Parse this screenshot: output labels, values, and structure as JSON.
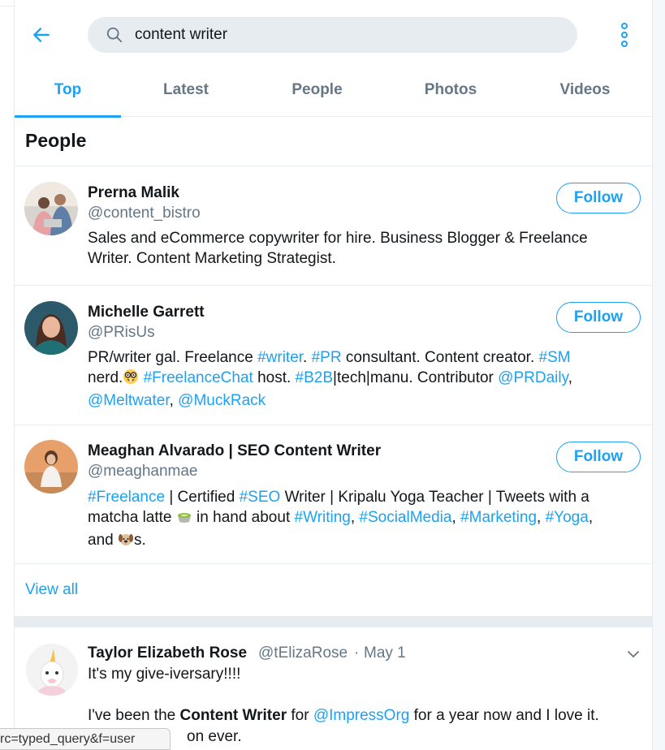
{
  "search": {
    "query": "content writer",
    "back_icon": "arrow-left-icon",
    "search_icon": "search-icon",
    "more_icon": "vertical-dots-icon"
  },
  "tabs": [
    {
      "label": "Top",
      "active": true
    },
    {
      "label": "Latest",
      "active": false
    },
    {
      "label": "People",
      "active": false
    },
    {
      "label": "Photos",
      "active": false
    },
    {
      "label": "Videos",
      "active": false
    }
  ],
  "people_section": {
    "title": "People",
    "view_all_label": "View all",
    "follow_label": "Follow",
    "people": [
      {
        "name": "Prerna Malik",
        "handle": "@content_bistro",
        "bio": {
          "line1": "Sales and eCommerce copywriter for hire. Business Blogger & Freelance",
          "line2": "Writer. Content Marketing Strategist."
        }
      },
      {
        "name": "Michelle Garrett",
        "handle": "@PRisUs",
        "bio": {
          "l1_a": "PR/writer gal. Freelance ",
          "l1_b": "#writer",
          "l1_c": ". ",
          "l1_d": "#PR",
          "l1_e": " consultant. Content creator. ",
          "l1_f": "#SM",
          "l2_a": "nerd.",
          "l2_emoji": "nerd-face-emoji",
          "l2_b": " ",
          "l2_c": "#FreelanceChat",
          "l2_d": " host. ",
          "l2_e": "#B2B",
          "l2_f": "|tech|manu. Contributor ",
          "l2_g": "@PRDaily",
          "l2_h": ",",
          "l3_a": "@Meltwater",
          "l3_b": ", ",
          "l3_c": "@MuckRack"
        }
      },
      {
        "name": "Meaghan Alvarado | SEO Content Writer",
        "handle": "@meaghanmae",
        "bio": {
          "l1_a": "#Freelance",
          "l1_b": " | Certified ",
          "l1_c": "#SEO",
          "l1_d": " Writer | Kripalu Yoga Teacher | Tweets with a",
          "l2_a": "matcha latte ",
          "l2_emoji": "matcha-cup-emoji",
          "l2_b": " in hand about ",
          "l2_c": "#Writing",
          "l2_d": ", ",
          "l2_e": "#SocialMedia",
          "l2_f": ", ",
          "l2_g": "#Marketing",
          "l2_h": ", ",
          "l2_i": "#Yoga",
          "l2_j": ",",
          "l3_a": "and ",
          "l3_emoji": "dog-face-emoji",
          "l3_b": "s."
        }
      }
    ]
  },
  "tweet": {
    "name": "Taylor Elizabeth Rose",
    "handle": "@tElizaRose",
    "separator": "·",
    "date": "May 1",
    "line1": "It's my give-iversary!!!!",
    "line2_a": "I've been the ",
    "line2_b": "Content Writer",
    "line2_c": " for ",
    "line2_d": "@ImpressOrg",
    "line2_e": " for a year now and I love it.",
    "line3": "on ever.",
    "caret_icon": "chevron-down-icon"
  },
  "status_bar": {
    "url_text": "rc=typed_query&f=user"
  },
  "colors": {
    "accent": "#1da1f2",
    "text_primary": "#14171a",
    "text_secondary": "#657786",
    "divider": "#e6ecf0"
  }
}
